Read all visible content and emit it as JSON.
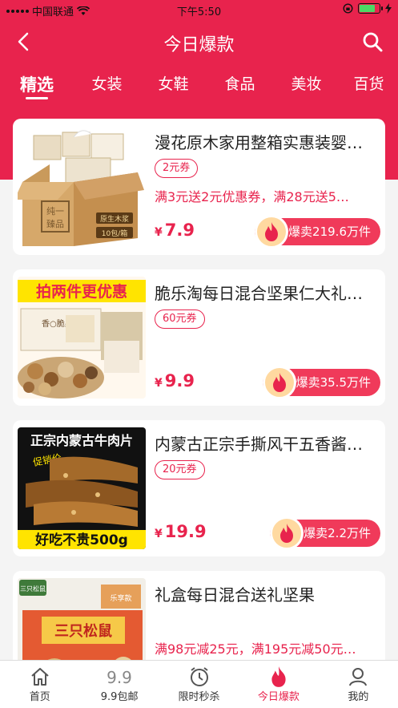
{
  "status": {
    "carrier": "中国联通",
    "time": "下午5:50"
  },
  "header": {
    "title": "今日爆款"
  },
  "tabs": [
    "精选",
    "女装",
    "女鞋",
    "食品",
    "美妆",
    "百货"
  ],
  "products": [
    {
      "title": "漫花原木家用整箱实惠装婴…",
      "coupon": "2元券",
      "promo": "满3元送2元优惠券，满28元送5…",
      "price": "7.9",
      "sold": "爆卖219.6万件",
      "image_texts": [
        "原生木浆",
        "10包/箱",
        "纯一臻品"
      ]
    },
    {
      "title": "脆乐淘每日混合坚果仁大礼…",
      "coupon": "60元券",
      "promo": "",
      "price": "9.9",
      "sold": "爆卖35.5万件",
      "image_texts": [
        "拍两件更优惠"
      ]
    },
    {
      "title": "内蒙古正宗手撕风干五香酱…",
      "coupon": "20元券",
      "promo": "",
      "price": "19.9",
      "sold": "爆卖2.2万件",
      "image_texts": [
        "正宗内蒙古牛肉片",
        "促销价",
        "好吃不贵500g"
      ]
    },
    {
      "title": "礼盒每日混合送礼坚果",
      "coupon": "",
      "promo": "满98元减25元，满195元减50元…",
      "price": "",
      "sold": "",
      "image_texts": [
        "三只松鼠",
        "乐享款"
      ]
    }
  ],
  "price_symbol": "¥",
  "tabbar": [
    {
      "label": "首页",
      "icon": "home-icon"
    },
    {
      "label": "9.9包邮",
      "icon": "nine-nine-icon"
    },
    {
      "label": "限时秒杀",
      "icon": "clock-icon"
    },
    {
      "label": "今日爆款",
      "icon": "fire-icon"
    },
    {
      "label": "我的",
      "icon": "user-icon"
    }
  ],
  "colors": {
    "brand": "#e8234d",
    "battery": "#4cd964"
  }
}
